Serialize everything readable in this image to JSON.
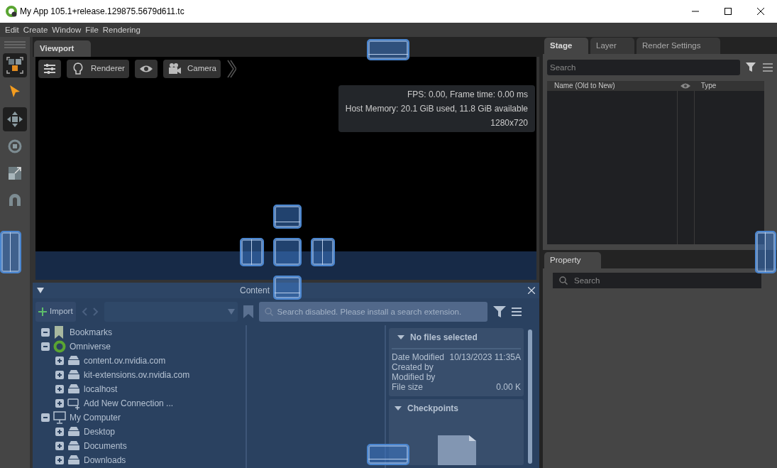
{
  "window": {
    "title": "My App 105.1+release.129875.5679d611.tc"
  },
  "menu": [
    "Edit",
    "Create",
    "Window",
    "File",
    "Rendering"
  ],
  "tools": [
    {
      "kind": "cubes",
      "selected": true
    },
    {
      "kind": "pointer",
      "selected": false
    },
    {
      "kind": "move",
      "selected": true
    },
    {
      "kind": "rotate",
      "selected": false
    },
    {
      "kind": "scale",
      "selected": false
    },
    {
      "kind": "magnet",
      "selected": false
    }
  ],
  "viewport": {
    "tab": "Viewport",
    "toolbar": [
      {
        "kind": "settings"
      },
      {
        "kind": "renderer",
        "label": "Renderer"
      },
      {
        "kind": "eye"
      },
      {
        "kind": "camera",
        "label": "Camera"
      }
    ],
    "stats": [
      "FPS: 0.00, Frame time: 0.00 ms",
      "Host Memory: 20.1 GiB used, 11.8 GiB available",
      "1280x720"
    ]
  },
  "stage": {
    "tabs": [
      {
        "label": "Stage",
        "selected": true
      },
      {
        "label": "Layer",
        "selected": false
      },
      {
        "label": "Render Settings",
        "selected": false
      }
    ],
    "search": {
      "placeholder": "Search"
    },
    "columns": [
      {
        "kind": "text",
        "label": "Name (Old to New)"
      },
      {
        "kind": "eye"
      },
      {
        "kind": "text",
        "label": "Type"
      }
    ]
  },
  "property": {
    "tab": "Property",
    "search": {
      "placeholder": "Search"
    }
  },
  "content": {
    "title": "Content",
    "import": "Import",
    "search": {
      "placeholder": "Search disabled. Please install a search extension."
    },
    "tree": [
      {
        "label": "Bookmarks",
        "kind": "bookmark",
        "expanded": true
      },
      {
        "label": "Omniverse",
        "kind": "omniverse",
        "expanded": true,
        "children": [
          {
            "label": "content.ov.nvidia.com",
            "kind": "server",
            "expanded": false
          },
          {
            "label": "kit-extensions.ov.nvidia.com",
            "kind": "server",
            "expanded": false
          },
          {
            "label": "localhost",
            "kind": "server",
            "expanded": false
          },
          {
            "label": "Add New Connection ...",
            "kind": "add",
            "expanded": false
          }
        ]
      },
      {
        "label": "My Computer",
        "kind": "computer",
        "expanded": true,
        "children": [
          {
            "label": "Desktop",
            "kind": "server",
            "expanded": false
          },
          {
            "label": "Documents",
            "kind": "server",
            "expanded": false
          },
          {
            "label": "Downloads",
            "kind": "server",
            "expanded": false
          }
        ]
      }
    ],
    "details": {
      "title": "No files selected",
      "expanded": true,
      "rows": [
        {
          "label": "Date Modified",
          "value": "10/13/2023 11:35A"
        },
        {
          "label": "Created by",
          "value": ""
        },
        {
          "label": "Modified by",
          "value": ""
        },
        {
          "label": "File size",
          "value": "0.00 K"
        }
      ]
    },
    "checkpoints": {
      "title": "Checkpoints",
      "expanded": true
    }
  }
}
